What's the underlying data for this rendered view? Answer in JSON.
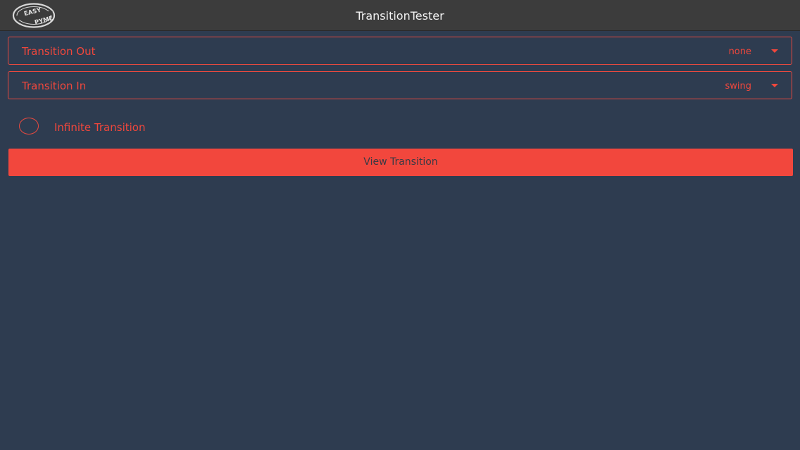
{
  "window": {
    "title": "TransitionTester"
  },
  "logo": {
    "top_text": "EASY",
    "bottom_text": "PYME"
  },
  "transition_out": {
    "label": "Transition Out",
    "selected_value": "none"
  },
  "transition_in": {
    "label": "Transition In",
    "selected_value": "swing"
  },
  "infinite": {
    "label": "Infinite Transition",
    "checked": false
  },
  "actions": {
    "view_label": "View Transition"
  },
  "colors": {
    "background": "#2e3c50",
    "titlebar": "#3c3c3c",
    "accent": "#f0473c",
    "title_text": "#f2f2f2"
  },
  "icons": {
    "dropdown": "chevron-down-icon",
    "checkbox": "radio-circle-icon"
  }
}
